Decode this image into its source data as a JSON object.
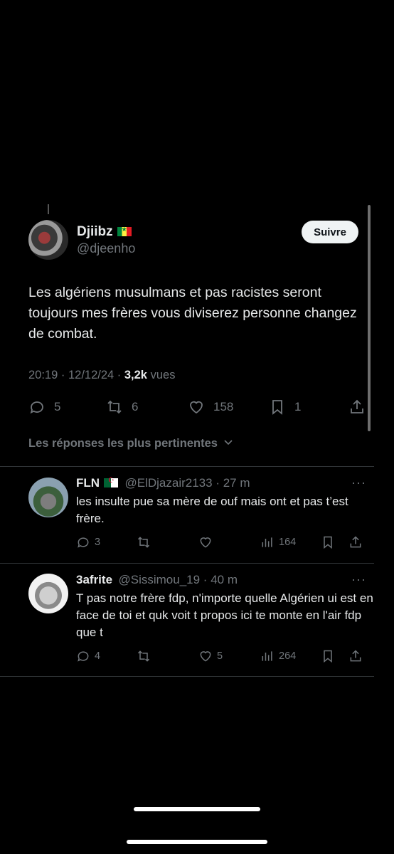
{
  "main_tweet": {
    "name": "Djiibz",
    "handle": "@djeenho",
    "follow_label": "Suivre",
    "text": "Les algériens musulmans et pas racistes seront toujours mes frères vous diviserez personne changez de combat.",
    "time": "20:19",
    "date": "12/12/24",
    "views_count": "3,2k",
    "views_label": "vues",
    "replies": "5",
    "reposts": "6",
    "likes": "158",
    "bookmarks": "1"
  },
  "replies_header": "Les réponses les plus pertinentes",
  "replies": [
    {
      "name": "FLN",
      "handle": "@ElDjazair2133",
      "time": "27 m",
      "text": "les insulte pue sa mère de ouf mais ont et pas t’est frère.",
      "replies": "3",
      "reposts": "",
      "likes": "",
      "views": "164"
    },
    {
      "name": "3afrite",
      "handle": "@Sissimou_19",
      "time": "40 m",
      "text": "T pas notre frère fdp, n'importe quelle Algérien ui est en face de toi et quk voit t propos ici te monte en l'air fdp que t",
      "replies": "4",
      "reposts": "",
      "likes": "5",
      "views": "264"
    }
  ],
  "icons": {
    "reply": "speech-bubble-icon",
    "repost": "repost-icon",
    "like": "heart-icon",
    "views": "bar-chart-icon",
    "bookmark": "bookmark-icon",
    "share": "share-icon",
    "more": "more-dots-icon"
  }
}
